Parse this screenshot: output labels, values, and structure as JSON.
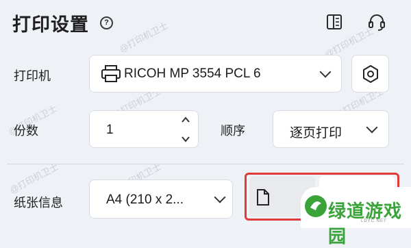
{
  "header": {
    "title": "打印设置",
    "help_icon": "?"
  },
  "printer": {
    "label": "打印机",
    "selected": "RICOH MP 3554 PCL 6"
  },
  "copies": {
    "label": "份数",
    "value": "1"
  },
  "order": {
    "label": "顺序",
    "selected": "逐页打印"
  },
  "paper": {
    "label": "纸张信息",
    "selected": "A4 (210 x 2..."
  },
  "watermark": {
    "text": "@打印机卫士"
  },
  "badge": {
    "title": "绿道游戏园",
    "subtitle": "LDYC.NET"
  },
  "colors": {
    "highlight": "#e03a3a",
    "badge_green": "#3aa33a"
  }
}
